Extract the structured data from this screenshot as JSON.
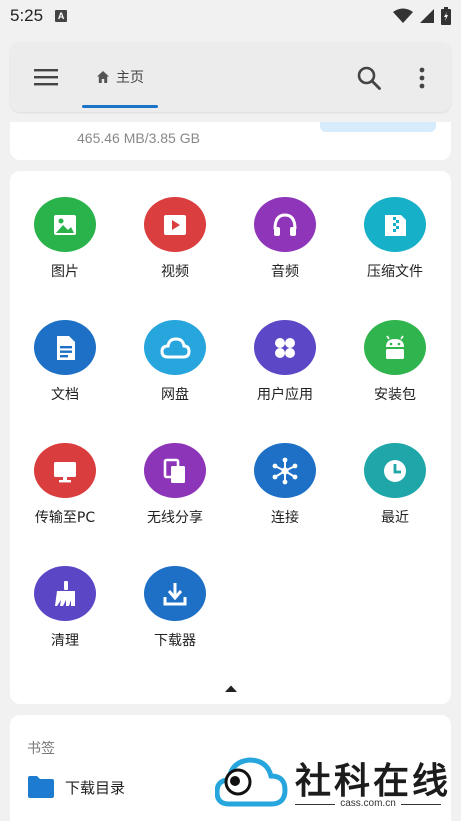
{
  "status_bar": {
    "time": "5:25",
    "notif_glyph": "A"
  },
  "header": {
    "home_tab": "主页"
  },
  "storage": {
    "usage": "465.46 MB/3.85 GB"
  },
  "categories": [
    {
      "label": "图片",
      "color": "#2ab24b",
      "icon": "image-icon"
    },
    {
      "label": "视频",
      "color": "#db3e3e",
      "icon": "video-icon"
    },
    {
      "label": "音频",
      "color": "#8e35ba",
      "icon": "headphones-icon"
    },
    {
      "label": "压缩文件",
      "color": "#17b0c9",
      "icon": "archive-icon"
    },
    {
      "label": "文档",
      "color": "#1d70c5",
      "icon": "document-icon"
    },
    {
      "label": "网盘",
      "color": "#27a6de",
      "icon": "cloud-icon"
    },
    {
      "label": "用户应用",
      "color": "#5c47c7",
      "icon": "apps-icon"
    },
    {
      "label": "安装包",
      "color": "#30b44e",
      "icon": "android-icon"
    },
    {
      "label": "传输至PC",
      "color": "#d93d3d",
      "icon": "monitor-icon"
    },
    {
      "label": "无线分享",
      "color": "#8c35b8",
      "icon": "share-icon"
    },
    {
      "label": "连接",
      "color": "#1d70c5",
      "icon": "network-icon"
    },
    {
      "label": "最近",
      "color": "#1ea6a8",
      "icon": "clock-icon"
    },
    {
      "label": "清理",
      "color": "#5b47c6",
      "icon": "broom-icon"
    },
    {
      "label": "下载器",
      "color": "#1d70c5",
      "icon": "download-icon"
    }
  ],
  "bookmarks": {
    "title": "书签",
    "items": [
      {
        "label": "下载目录"
      }
    ]
  },
  "watermark": {
    "brand": "社科在线",
    "domain": "cass.com.cn"
  }
}
